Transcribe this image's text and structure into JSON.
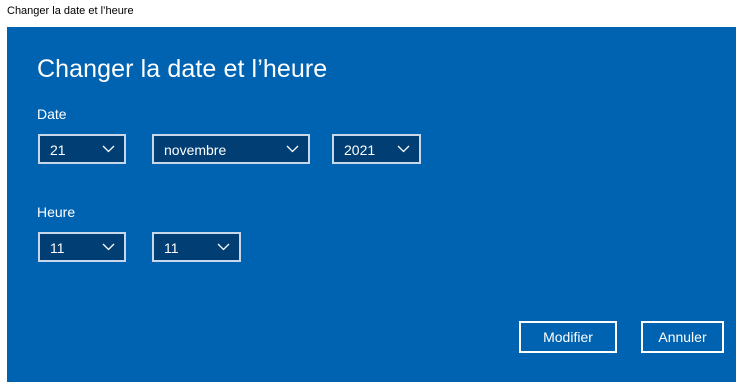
{
  "window": {
    "title": "Changer la date et l’heure"
  },
  "dialog": {
    "heading": "Changer la date et l’heure",
    "date_label": "Date",
    "time_label": "Heure",
    "day": "21",
    "month": "novembre",
    "year": "2021",
    "hour": "11",
    "minute": "11",
    "modify_label": "Modifier",
    "cancel_label": "Annuler"
  },
  "icons": {
    "dropdown": "chevron-down-icon"
  },
  "colors": {
    "dialog_background": "#0063b1",
    "select_background": "#003e73",
    "text": "#ffffff"
  }
}
